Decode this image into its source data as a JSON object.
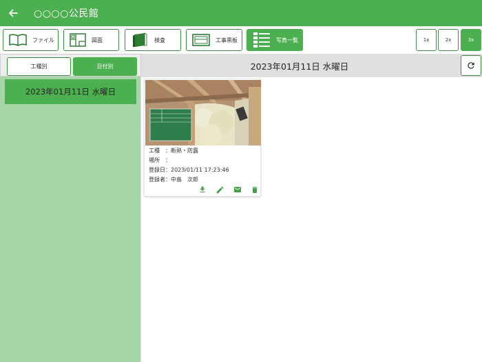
{
  "header": {
    "title": "○○○○公民館"
  },
  "toolbar": {
    "buttons": [
      {
        "label": "ファイル",
        "icon": "book-icon"
      },
      {
        "label": "図面",
        "icon": "floorplan-icon"
      },
      {
        "label": "検査",
        "icon": "binder-icon"
      },
      {
        "label": "工事黒板",
        "icon": "blackboard-icon"
      },
      {
        "label": "写真一覧",
        "icon": "photo-list-icon"
      }
    ],
    "zoom": [
      "1x",
      "2x",
      "3x"
    ],
    "zoom_selected": "3x"
  },
  "sidebar": {
    "tabs": [
      "工種別",
      "日付別"
    ],
    "active_tab": "日付別",
    "items": [
      {
        "label": "2023年01月11日 水曜日"
      }
    ]
  },
  "main": {
    "title": "2023年01月11日 水曜日",
    "photos": [
      {
        "rows": [
          {
            "key": "工種",
            "sep": "：",
            "value": "断熱・防露"
          },
          {
            "key": "場所",
            "sep": "：",
            "value": ""
          },
          {
            "key": "登録日",
            "sep": "：",
            "value": "2023/01/11 17:23:46"
          },
          {
            "key": "登録者",
            "sep": "：",
            "value": "中島　次郎"
          }
        ]
      }
    ]
  },
  "colors": {
    "primary": "#4caf50",
    "sidebar_bg": "#a5d6a7",
    "header_bar": "#e0e0e0"
  }
}
